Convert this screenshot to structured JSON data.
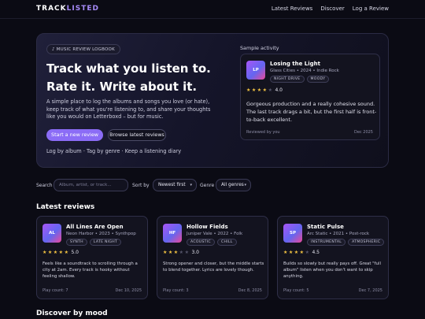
{
  "header": {
    "brand_a": "TRACK",
    "brand_b": "LISTED",
    "nav": [
      "Latest Reviews",
      "Discover",
      "Log a Review"
    ]
  },
  "hero": {
    "chip_icon": "music-note-icon",
    "chip": "♪ MUSIC REVIEW LOGBOOK",
    "title": "Track what you listen to. Rate it. Write about it.",
    "description": "A simple place to log the albums and songs you love (or hate), keep track of what you're listening to, and share your thoughts like you would on Letterboxd – but for music.",
    "primary_button": "Start a new review",
    "secondary_button": "Browse latest reviews",
    "features": "Log by album · Tag by genre · Keep a listening diary"
  },
  "sample": {
    "label": "Sample activity",
    "cover": "LP",
    "title": "Losing the Light",
    "meta": "Glass Cities • 2024 • Indie Rock",
    "tags": [
      "NIGHT DRIVE",
      "MOODY"
    ],
    "rating": "4.0",
    "stars_filled": 4,
    "body": "Gorgeous production and a really cohesive sound. The last track drags a bit, but the first half is front-to-back excellent.",
    "footer_left": "Reviewed by you",
    "footer_right": "Dec 2025"
  },
  "filters": {
    "search_label": "Search",
    "search_placeholder": "Album, artist, or track...",
    "sort_label": "Sort by",
    "sort_value": "Newest first",
    "genre_label": "Genre",
    "genre_value": "All genres"
  },
  "latest": {
    "title": "Latest reviews",
    "cards": [
      {
        "cover": "AL",
        "title": "All Lines Are Open",
        "meta": "Neon Harbor • 2023 • Synthpop",
        "tags": [
          "SYNTH",
          "LATE NIGHT"
        ],
        "rating": "5.0",
        "stars_filled": 5,
        "body": "Feels like a soundtrack to scrolling through a city at 2am. Every track is hooky without feeling shallow.",
        "play_count": "Play count: 7",
        "date": "Dec 10, 2025"
      },
      {
        "cover": "HF",
        "title": "Hollow Fields",
        "meta": "Juniper Vale • 2022 • Folk",
        "tags": [
          "ACOUSTIC",
          "CHILL"
        ],
        "rating": "3.0",
        "stars_filled": 3,
        "body": "Strong opener and closer, but the middle starts to blend together. Lyrics are lovely though.",
        "play_count": "Play count: 3",
        "date": "Dec 8, 2025"
      },
      {
        "cover": "SP",
        "title": "Static Pulse",
        "meta": "Arc Static • 2021 • Post-rock",
        "tags": [
          "INSTRUMENTAL",
          "ATMOSPHERIC"
        ],
        "rating": "4.5",
        "stars_filled": 4,
        "body": "Builds so slowly but really pays off. Great \"full album\" listen when you don't want to skip anything.",
        "play_count": "Play count: 5",
        "date": "Dec 7, 2025"
      }
    ]
  },
  "mood": {
    "title": "Discover by mood"
  }
}
